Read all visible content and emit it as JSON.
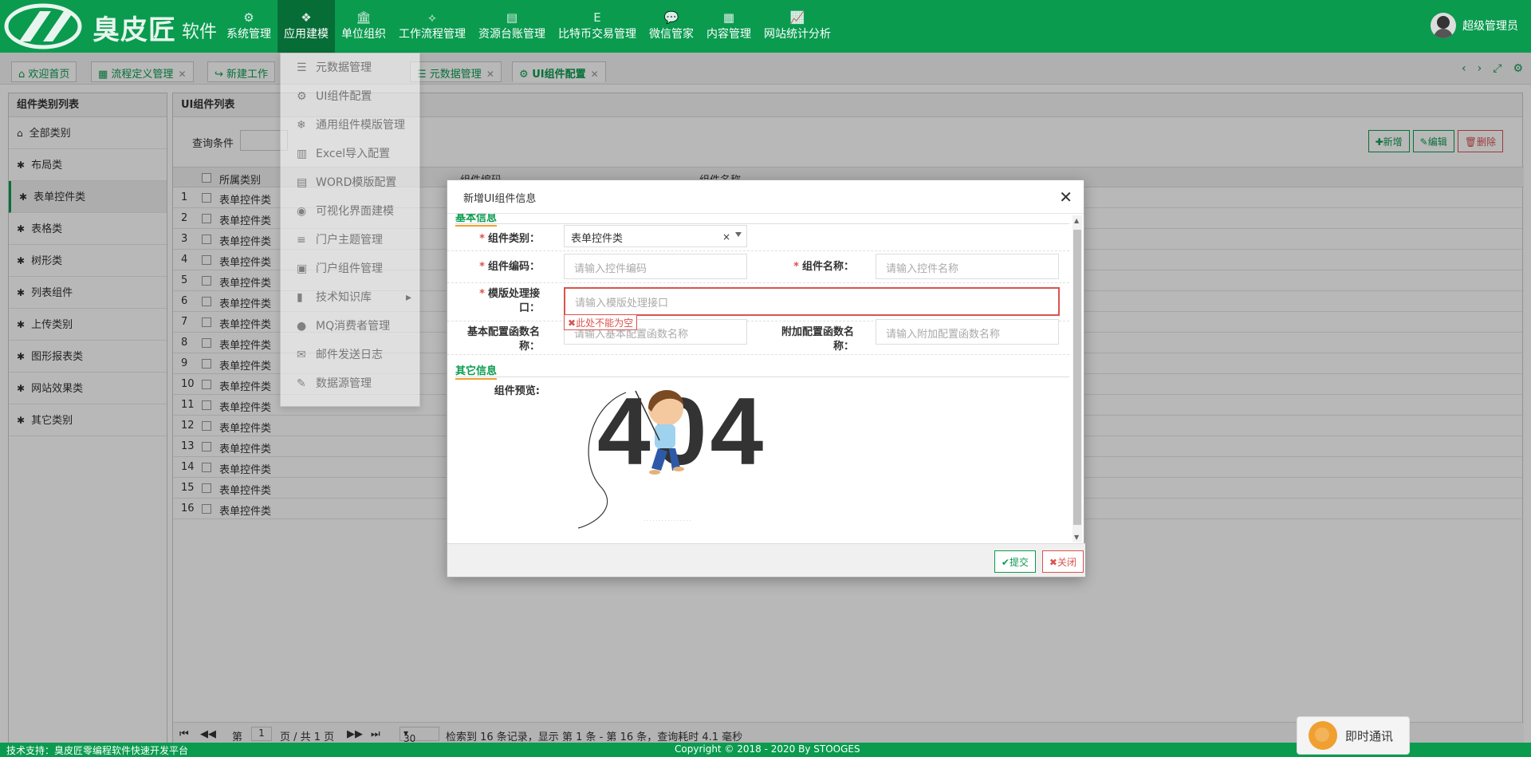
{
  "brand": {
    "name": "臭皮匠",
    "sub": "软件"
  },
  "nav": [
    {
      "label": "系统管理",
      "icon": "gears-icon",
      "glyph": "⚙"
    },
    {
      "label": "应用建模",
      "icon": "cubes-icon",
      "glyph": "❖"
    },
    {
      "label": "单位组织",
      "icon": "bank-icon",
      "glyph": "🏛"
    },
    {
      "label": "工作流程管理",
      "icon": "sitemap-icon",
      "glyph": "⟡"
    },
    {
      "label": "资源台账管理",
      "icon": "database-icon",
      "glyph": "▤"
    },
    {
      "label": "比特币交易管理",
      "icon": "euro-icon",
      "glyph": "E"
    },
    {
      "label": "微信管家",
      "icon": "chat-icon",
      "glyph": "💬"
    },
    {
      "label": "内容管理",
      "icon": "newspaper-icon",
      "glyph": "▦"
    },
    {
      "label": "网站统计分析",
      "icon": "chart-icon",
      "glyph": "📈"
    }
  ],
  "user": {
    "name": "超级管理员"
  },
  "tabs": [
    {
      "label": "欢迎首页",
      "icon": "⌂"
    },
    {
      "label": "流程定义管理",
      "icon": "▦",
      "closable": true
    },
    {
      "label": "新建工作",
      "icon": "↪"
    },
    {
      "label": "元数据管理",
      "icon": "☰",
      "closable": true
    },
    {
      "label": "UI组件配置",
      "icon": "⚙",
      "closable": true
    }
  ],
  "dropdown": [
    {
      "label": "元数据管理",
      "glyph": "☰"
    },
    {
      "label": "UI组件配置",
      "glyph": "⚙"
    },
    {
      "label": "通用组件模版管理",
      "glyph": "❄"
    },
    {
      "label": "Excel导入配置",
      "glyph": "▥"
    },
    {
      "label": "WORD模版配置",
      "glyph": "▤"
    },
    {
      "label": "可视化界面建模",
      "glyph": "◉"
    },
    {
      "label": "门户主题管理",
      "glyph": "≡"
    },
    {
      "label": "门户组件管理",
      "glyph": "▣"
    },
    {
      "label": "技术知识库",
      "glyph": "▮",
      "arrow": "▸"
    },
    {
      "label": "MQ消费者管理",
      "glyph": "●"
    },
    {
      "label": "邮件发送日志",
      "glyph": "✉"
    },
    {
      "label": "数据源管理",
      "glyph": "✎"
    }
  ],
  "leftpanel": {
    "title": "组件类别列表",
    "items": [
      "全部类别",
      "布局类",
      "表单控件类",
      "表格类",
      "树形类",
      "列表组件",
      "上传类别",
      "图形报表类",
      "网站效果类",
      "其它类别"
    ]
  },
  "main": {
    "title": "UI组件列表",
    "query_label": "查询条件",
    "buttons": {
      "add": "新增",
      "edit": "编辑",
      "delete": "删除"
    },
    "columns": {
      "category": "所属类别",
      "code": "组件编码",
      "name": "组件名称"
    },
    "rows": [
      "1",
      "2",
      "3",
      "4",
      "5",
      "6",
      "7",
      "8",
      "9",
      "10",
      "11",
      "12",
      "13",
      "14",
      "15",
      "16"
    ],
    "row_value": "表单控件类",
    "pager": {
      "page_label": "第",
      "page": "1",
      "of": "页 / 共 1 页",
      "size": "30",
      "info": "检索到 16 条记录，显示 第 1 条 - 第 16 条，查询耗时 4.1 毫秒"
    }
  },
  "modal": {
    "title": "新增UI组件信息",
    "section1": "基本信息",
    "section2": "其它信息",
    "category_label": "组件类别：",
    "category_value": "表单控件类",
    "code_label": "组件编码：",
    "code_placeholder": "请输入控件编码",
    "name_label": "组件名称：",
    "name_placeholder": "请输入控件名称",
    "tpl_label_1": "模版处理接",
    "tpl_label_2": "口：",
    "tpl_placeholder": "请输入模版处理接口",
    "error": "此处不能为空",
    "basefn_label_1": "基本配置函数名",
    "basefn_label_2": "称：",
    "basefn_placeholder": "请输入基本配置函数名称",
    "extfn_label_1": "附加配置函数名",
    "extfn_label_2": "称：",
    "extfn_placeholder": "请输入附加配置函数名称",
    "preview_label": "组件预览:",
    "preview_404": "404",
    "submit": "提交",
    "close": "关闭"
  },
  "footer": {
    "left": "技术支持：臭皮匠零编程软件快速开发平台",
    "center": "Copyright © 2018 - 2020 By STOOGES"
  },
  "chat": {
    "label": "即时通讯"
  },
  "colors": {
    "brand": "#0a9b4f",
    "danger": "#d9534f",
    "accent": "#f0a030"
  }
}
